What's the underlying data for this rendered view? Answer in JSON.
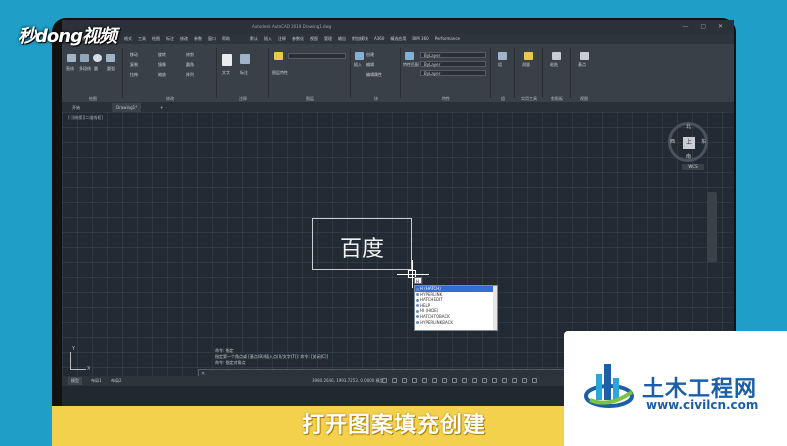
{
  "watermark": {
    "brand": "秒dong视频"
  },
  "app": {
    "title_bar": "Autodesk AutoCAD 2019  Drawing1.dwg",
    "window_buttons": "— ▢ ✕"
  },
  "menu": [
    "文件",
    "编辑",
    "视图",
    "插入",
    "格式",
    "工具",
    "绘图",
    "标注",
    "修改",
    "参数",
    "窗口",
    "帮助"
  ],
  "ribbon": {
    "tabs": [
      "默认",
      "插入",
      "注释",
      "参数化",
      "视图",
      "管理",
      "输出",
      "附加模块",
      "A360",
      "精选应用",
      "BIM 360",
      "Performance"
    ],
    "panels": {
      "draw": "绘图",
      "modify": "修改",
      "annotation": "注释",
      "layers": "图层",
      "block": "块",
      "properties": "特性",
      "groups": "组",
      "utilities": "实用工具",
      "clipboard": "剪贴板",
      "view": "视图"
    },
    "draw_tools": [
      "直线",
      "多段线",
      "圆",
      "圆弧"
    ],
    "modify_tools": [
      "移动",
      "旋转",
      "修剪",
      "复制",
      "镜像",
      "圆角",
      "拉伸",
      "缩放",
      "阵列"
    ],
    "annotation_tools": [
      "文字",
      "标注"
    ],
    "layer_tools": [
      "图层特性"
    ],
    "block_tools": [
      "插入",
      "创建",
      "编辑",
      "编辑属性"
    ],
    "properties_values": [
      "ByLayer",
      "ByLayer",
      "ByLayer"
    ],
    "properties_tools": [
      "特性匹配"
    ],
    "groups_tools": [
      "组"
    ],
    "utilities_tools": [
      "测量"
    ],
    "clipboard_tools": [
      "粘贴"
    ],
    "view_tools": [
      "基点"
    ]
  },
  "doc_tabs": [
    "开始",
    "Drawing1*"
  ],
  "viewport_label": "[-][俯视][二维线框]",
  "canvas_text": "百度",
  "command_input": "H",
  "autocomplete": [
    "H (HATCH)",
    "HYPERLINK",
    "HATCHEDIT",
    "HELP",
    "HI (HIDE)",
    "HATCHTOBACK",
    "HYPERLINKBACK"
  ],
  "viewcube": {
    "top_face": "上",
    "north": "北",
    "south": "南",
    "east": "东",
    "west": "西",
    "wcs": "WCS"
  },
  "ucs": {
    "x": "X",
    "y": "Y"
  },
  "command_history": [
    "命令: 指定",
    "指定第一个角点或 [基点(B)/插入点(I)/文字(T)]: 命令: [关闭(C)]",
    "命令: 指定对角点"
  ],
  "status": {
    "layout_tabs": [
      "模型",
      "布局1",
      "布局2"
    ],
    "coordinates": "3980.2646, 1993.7253, 0.0000  模型"
  },
  "caption": "打开图案填充创建",
  "logo": {
    "title": "土木工程网",
    "url": "www.civilcn.com"
  },
  "colors": {
    "caption_bg": "#f4d14d",
    "logo_blue": "#1a5fa8",
    "canvas_bg": "#222a33",
    "selection": "#2f6fd6"
  }
}
